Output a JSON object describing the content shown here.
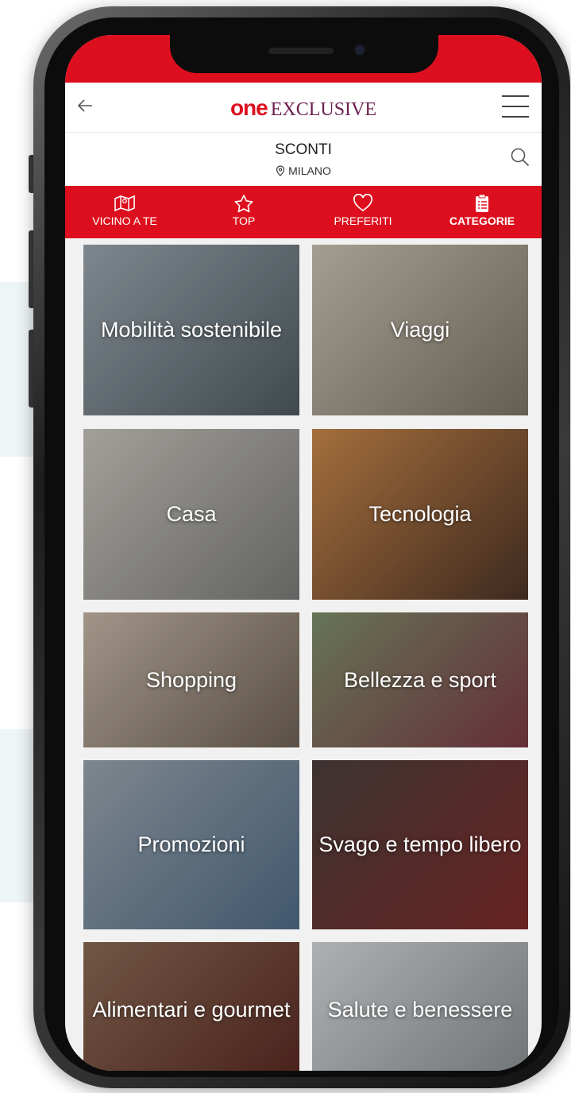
{
  "header": {
    "logo_one": "one",
    "logo_exclusive": "EXCLUSIVE"
  },
  "subheader": {
    "title": "SCONTI",
    "location": "MILANO"
  },
  "tabs": [
    {
      "label": "VICINO A TE",
      "icon": "map-icon",
      "active": false
    },
    {
      "label": "TOP",
      "icon": "star-icon",
      "active": false
    },
    {
      "label": "PREFERITI",
      "icon": "heart-icon",
      "active": false
    },
    {
      "label": "CATEGORIE",
      "icon": "clipboard-list-icon",
      "active": true
    }
  ],
  "categories": [
    {
      "label": "Mobilità sostenibile",
      "colors": [
        "#9aa5ad",
        "#4f5a60"
      ]
    },
    {
      "label": "Viaggi",
      "colors": [
        "#c9c1b3",
        "#7b7464"
      ]
    },
    {
      "label": "Casa",
      "colors": [
        "#c7c3bc",
        "#7a7a78"
      ]
    },
    {
      "label": "Tecnologia",
      "colors": [
        "#c9874a",
        "#4c3326"
      ]
    },
    {
      "label": "Shopping",
      "colors": [
        "#c4b6a6",
        "#6f6156"
      ]
    },
    {
      "label": "Bellezza e sport",
      "colors": [
        "#7d8e6a",
        "#7b3a44"
      ]
    },
    {
      "label": "Promozioni",
      "colors": [
        "#9aa4ad",
        "#4f6b86"
      ]
    },
    {
      "label": "Svago e tempo libero",
      "colors": [
        "#4a3f3d",
        "#7e2b28"
      ]
    },
    {
      "label": "Alimentari e gourmet",
      "colors": [
        "#8a6a55",
        "#5a2a22"
      ]
    },
    {
      "label": "Salute e benessere",
      "colors": [
        "#d4d8da",
        "#8a8f92"
      ]
    }
  ],
  "colors": {
    "brand_red": "#dd0f1e",
    "logo_purple": "#6a1f4f"
  }
}
